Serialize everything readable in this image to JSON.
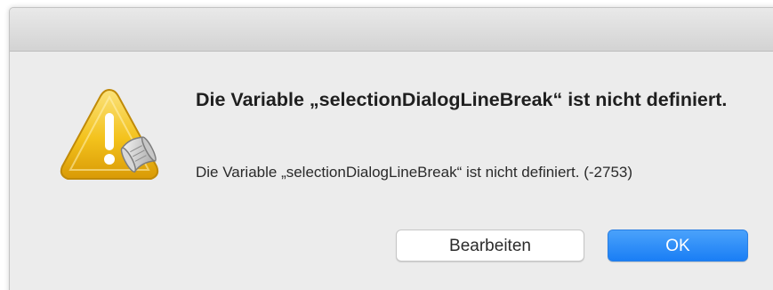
{
  "dialog": {
    "icon": "warning-script-icon",
    "title": "Die Variable „selectionDialogLineBreak“ ist nicht definiert.",
    "message": "Die Variable „selectionDialogLineBreak“ ist nicht definiert. (-2753)",
    "buttons": {
      "edit_label": "Bearbeiten",
      "ok_label": "OK"
    }
  },
  "colors": {
    "default_button": "#1a7ef5",
    "warning_yellow": "#f3c21c"
  }
}
